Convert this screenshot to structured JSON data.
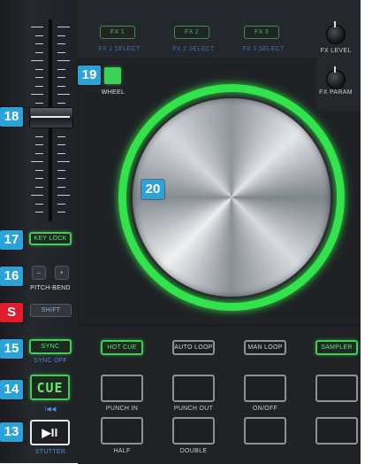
{
  "callouts": {
    "c19": "19",
    "c18": "18",
    "c20": "20",
    "c17": "17",
    "c16": "16",
    "cS": "S",
    "c15": "15",
    "c14": "14",
    "c13": "13"
  },
  "fx": {
    "buttons": [
      "FX 1",
      "FX 2",
      "FX 3"
    ],
    "selects": [
      "FX 1 SELECT",
      "FX 2 SELECT",
      "FX 3 SELECT"
    ],
    "level": "FX LEVEL",
    "param": "FX PARAM"
  },
  "wheel": {
    "label": "WHEEL"
  },
  "left": {
    "key_lock": "KEY LOCK",
    "pitch_minus": "–",
    "pitch_plus": "+",
    "pitch_bend": "PITCH-BEND",
    "shift": "SHIFT",
    "sync": "SYNC",
    "sync_off": "SYNC OFF",
    "cue": "CUE",
    "cue_sub": "I◀◀",
    "play": "▶II",
    "stutter": "STUTTER"
  },
  "modes": [
    "HOT CUE",
    "AUTO LOOP",
    "MAN LOOP",
    "SAMPLER"
  ],
  "pads": {
    "row1_labels": [
      "PUNCH IN",
      "PUNCH OUT",
      "ON/OFF",
      ""
    ],
    "row2_labels": [
      "HALF",
      "DOUBLE",
      "",
      ""
    ]
  },
  "colors": {
    "accent_green": "#3ecf55",
    "callout_blue": "#2aa3d8",
    "callout_red": "#e31c2d",
    "label_blue": "#4f8fd8"
  }
}
